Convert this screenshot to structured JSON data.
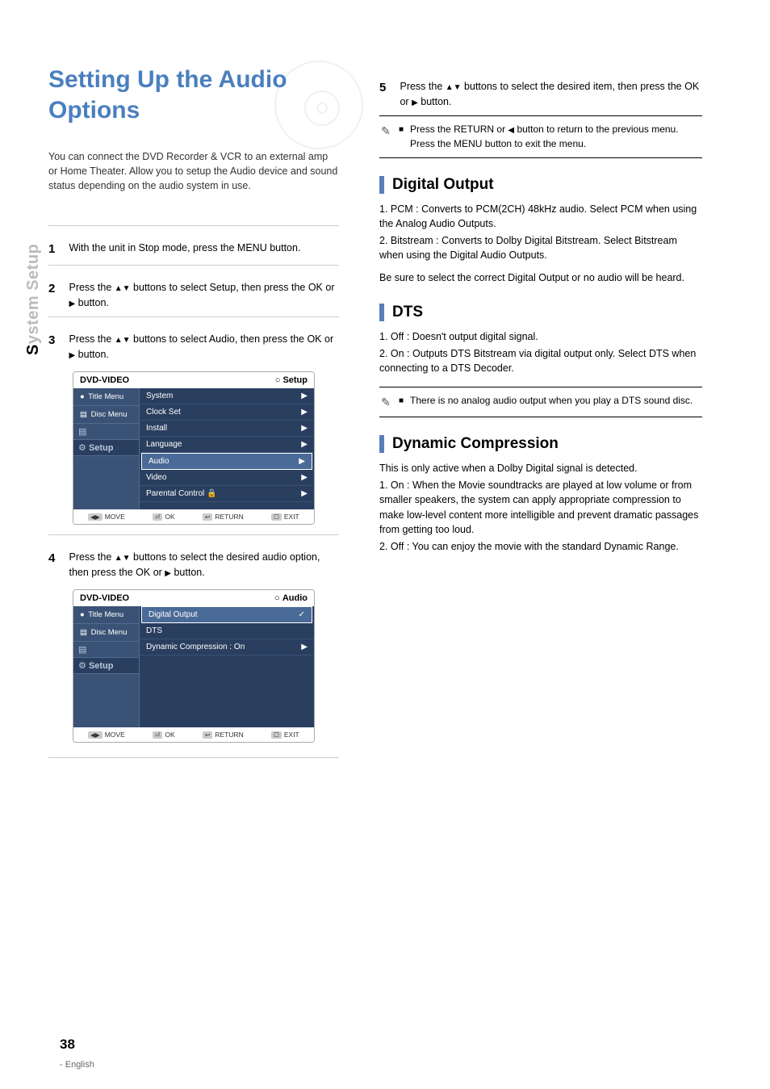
{
  "tab": {
    "letter": "S",
    "rest": "ystem Setup"
  },
  "title": "Setting Up the Audio Options",
  "intro": "You can connect the DVD Recorder & VCR to an external amp or Home Theater. Allow you to setup the Audio device and sound status depending on the audio system in use.",
  "steps": {
    "s1": {
      "num": "1",
      "text_a": "With the unit in Stop mode, press the MENU button."
    },
    "s2": {
      "num": "2",
      "pre": "Press the ",
      "tri": "▲▼",
      "mid": " buttons to select Setup, then press the OK or ",
      "tri2": "▶",
      "post": " button."
    },
    "s3": {
      "num": "3",
      "pre": "Press the ",
      "tri": "▲▼",
      "mid": " buttons to select Audio, then press the OK or ",
      "tri2": "▶",
      "post": " button."
    },
    "s4": {
      "num": "4",
      "pre": "Press the ",
      "tri": "▲▼",
      "mid": " buttons to select the desired audio option, then press the OK or ",
      "tri2": "▶",
      "post": " button."
    },
    "s5": {
      "num": "5",
      "pre": "Press the ",
      "tri": "▲▼",
      "mid": " buttons to select the desired item, then press the OK or ",
      "tri2": "▶",
      "post": " button."
    }
  },
  "notes": {
    "n_return": {
      "bullet": "■",
      "pre": "Press the RETURN or ",
      "tri": "◀",
      "post": " button to return to the previous menu. Press the MENU button to exit the menu."
    },
    "n_dts": {
      "bullet": "■",
      "text": "There is no analog audio output when you play a DTS sound disc."
    }
  },
  "sections": {
    "digital": {
      "title": "Digital Output",
      "pcm": "1. PCM : Converts to PCM(2CH) 48kHz audio. Select PCM when using the Analog Audio Outputs.",
      "bitstream": "2. Bitstream : Converts to Dolby Digital Bitstream. Select Bitstream when using the Digital Audio Outputs.",
      "note": "Be sure to select the correct Digital Output or no audio will be heard."
    },
    "dts": {
      "title": "DTS",
      "off": "1. Off : Doesn't output digital signal.",
      "on": "2. On : Outputs DTS Bitstream via digital output only. Select DTS when connecting to a DTS Decoder."
    },
    "dyn": {
      "title": "Dynamic Compression",
      "intro": "This is only active when a Dolby Digital signal is detected.",
      "on": "1. On : When the Movie soundtracks are played at low volume or from smaller speakers, the system can apply appropriate compression to make low-level content more intelligible and prevent dramatic passages from getting too loud.",
      "off": "2. Off : You can enjoy the movie with the standard Dynamic Range."
    }
  },
  "osd1": {
    "topLeft": "DVD-VIDEO",
    "topRight": "Setup",
    "side": [
      "Title Menu",
      "Disc Menu"
    ],
    "sideSetup": "Setup",
    "rows": [
      "System",
      "Clock Set",
      "Install",
      "Language",
      "Audio",
      "Video",
      "Parental Control"
    ],
    "footer": {
      "move": "MOVE",
      "ok": "OK",
      "ret": "RETURN",
      "exit": "EXIT"
    }
  },
  "osd2": {
    "topLeft": "DVD-VIDEO",
    "topRight": "Audio",
    "side": [
      "Title Menu",
      "Disc Menu"
    ],
    "sideSetup": "Setup",
    "rows": [
      {
        "label": "Digital Output",
        "val": ""
      },
      {
        "label": "DTS",
        "val": ""
      },
      {
        "label": "Dynamic Compression",
        "val": ": On"
      }
    ],
    "footer": {
      "move": "MOVE",
      "ok": "OK",
      "ret": "RETURN",
      "exit": "EXIT"
    }
  },
  "pageNum": "38",
  "footerNote": "English"
}
